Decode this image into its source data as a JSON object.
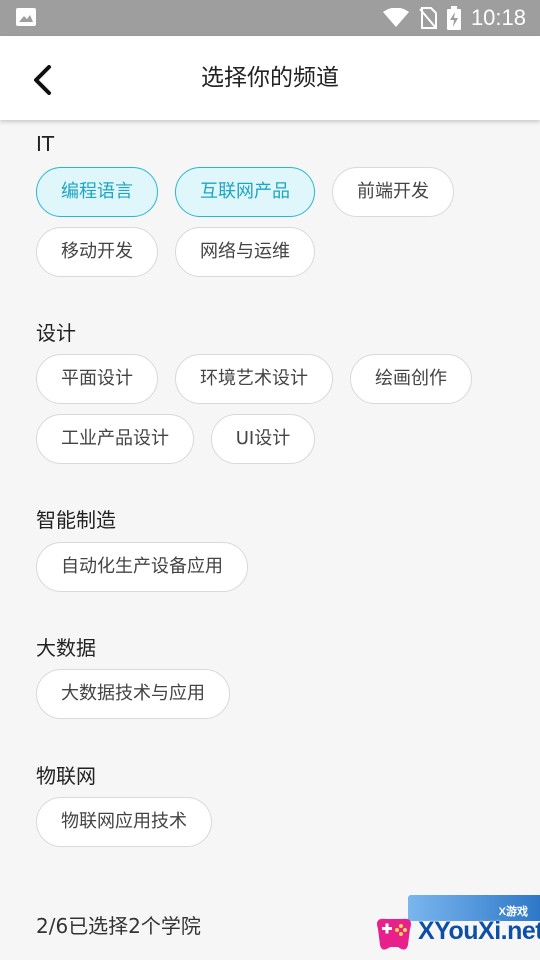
{
  "status_bar": {
    "time": "10:18"
  },
  "app_bar": {
    "title": "选择你的频道"
  },
  "sections": [
    {
      "title": "IT",
      "chips": [
        {
          "label": "编程语言",
          "selected": true
        },
        {
          "label": "互联网产品",
          "selected": true
        },
        {
          "label": "前端开发",
          "selected": false
        },
        {
          "label": "移动开发",
          "selected": false
        },
        {
          "label": "网络与运维",
          "selected": false
        }
      ]
    },
    {
      "title": "设计",
      "chips": [
        {
          "label": "平面设计",
          "selected": false
        },
        {
          "label": "环境艺术设计",
          "selected": false
        },
        {
          "label": "绘画创作",
          "selected": false
        },
        {
          "label": "工业产品设计",
          "selected": false
        },
        {
          "label": "UI设计",
          "selected": false
        }
      ]
    },
    {
      "title": "智能制造",
      "chips": [
        {
          "label": "自动化生产设备应用",
          "selected": false
        }
      ]
    },
    {
      "title": "大数据",
      "chips": [
        {
          "label": "大数据技术与应用",
          "selected": false
        }
      ]
    },
    {
      "title": "物联网",
      "chips": [
        {
          "label": "物联网应用技术",
          "selected": false
        }
      ]
    }
  ],
  "footer": {
    "selection_status": "2/6已选择2个学院"
  },
  "watermark": {
    "badge": "X游戏",
    "text": "XYouXi.net"
  },
  "colors": {
    "selected_border": "#29b6d6",
    "selected_bg": "#dff6fb",
    "selected_text": "#1ea5c6",
    "status_bar": "#9e9e9e"
  }
}
